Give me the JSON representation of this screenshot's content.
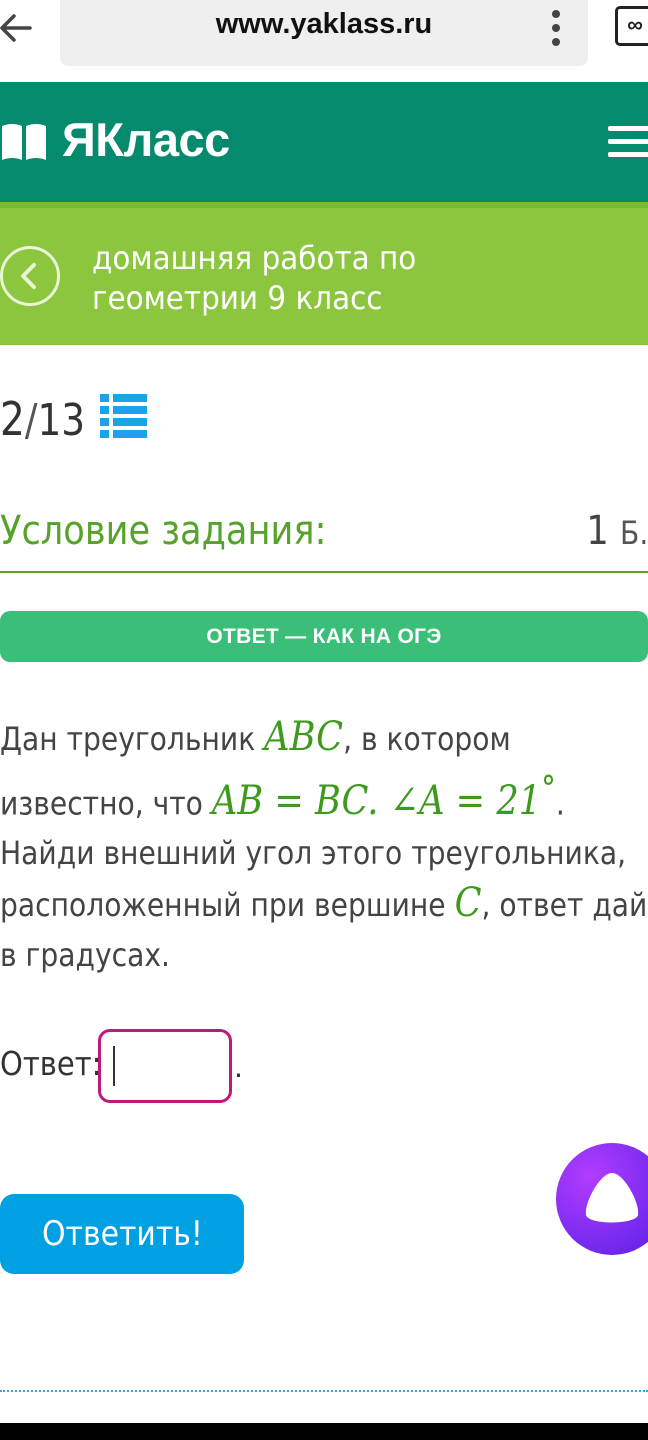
{
  "browser": {
    "url": "www.yaklass.ru",
    "tabs_symbol": "∞"
  },
  "header": {
    "logo_text": "ЯКласс",
    "brand_color": "#058a6e"
  },
  "subheader": {
    "title": "домашняя работа по геометрии 9 класс",
    "accent_color": "#8cc63f"
  },
  "progress": {
    "current": "2",
    "separator": "/",
    "total": "13"
  },
  "condition": {
    "title": "Условие задания:",
    "points": "1",
    "points_unit": "Б."
  },
  "banner": {
    "text": "ОТВЕТ — КАК НА ОГЭ"
  },
  "task": {
    "l1_a": "Дан треугольник ",
    "l1_m": "ABC",
    "l1_b": ", в котором",
    "l2_a": "известно, что ",
    "l2_m1": "AB = BC. ∠A = 21",
    "l2_deg": "°",
    "l2_b": ".",
    "l3": "Найди внешний угол этого треугольника,",
    "l4_a": "расположенный при вершине ",
    "l4_m": "C",
    "l4_b": ", ответ дай",
    "l5": "в градусах."
  },
  "answer": {
    "label": "Ответ:",
    "value": "",
    "suffix": "."
  },
  "submit": {
    "label": "Ответить!"
  },
  "icons": {
    "back": "arrow-left-icon",
    "more": "vertical-dots-icon",
    "menu": "hamburger-icon",
    "list": "list-icon",
    "assistant": "alice-assistant-icon"
  }
}
